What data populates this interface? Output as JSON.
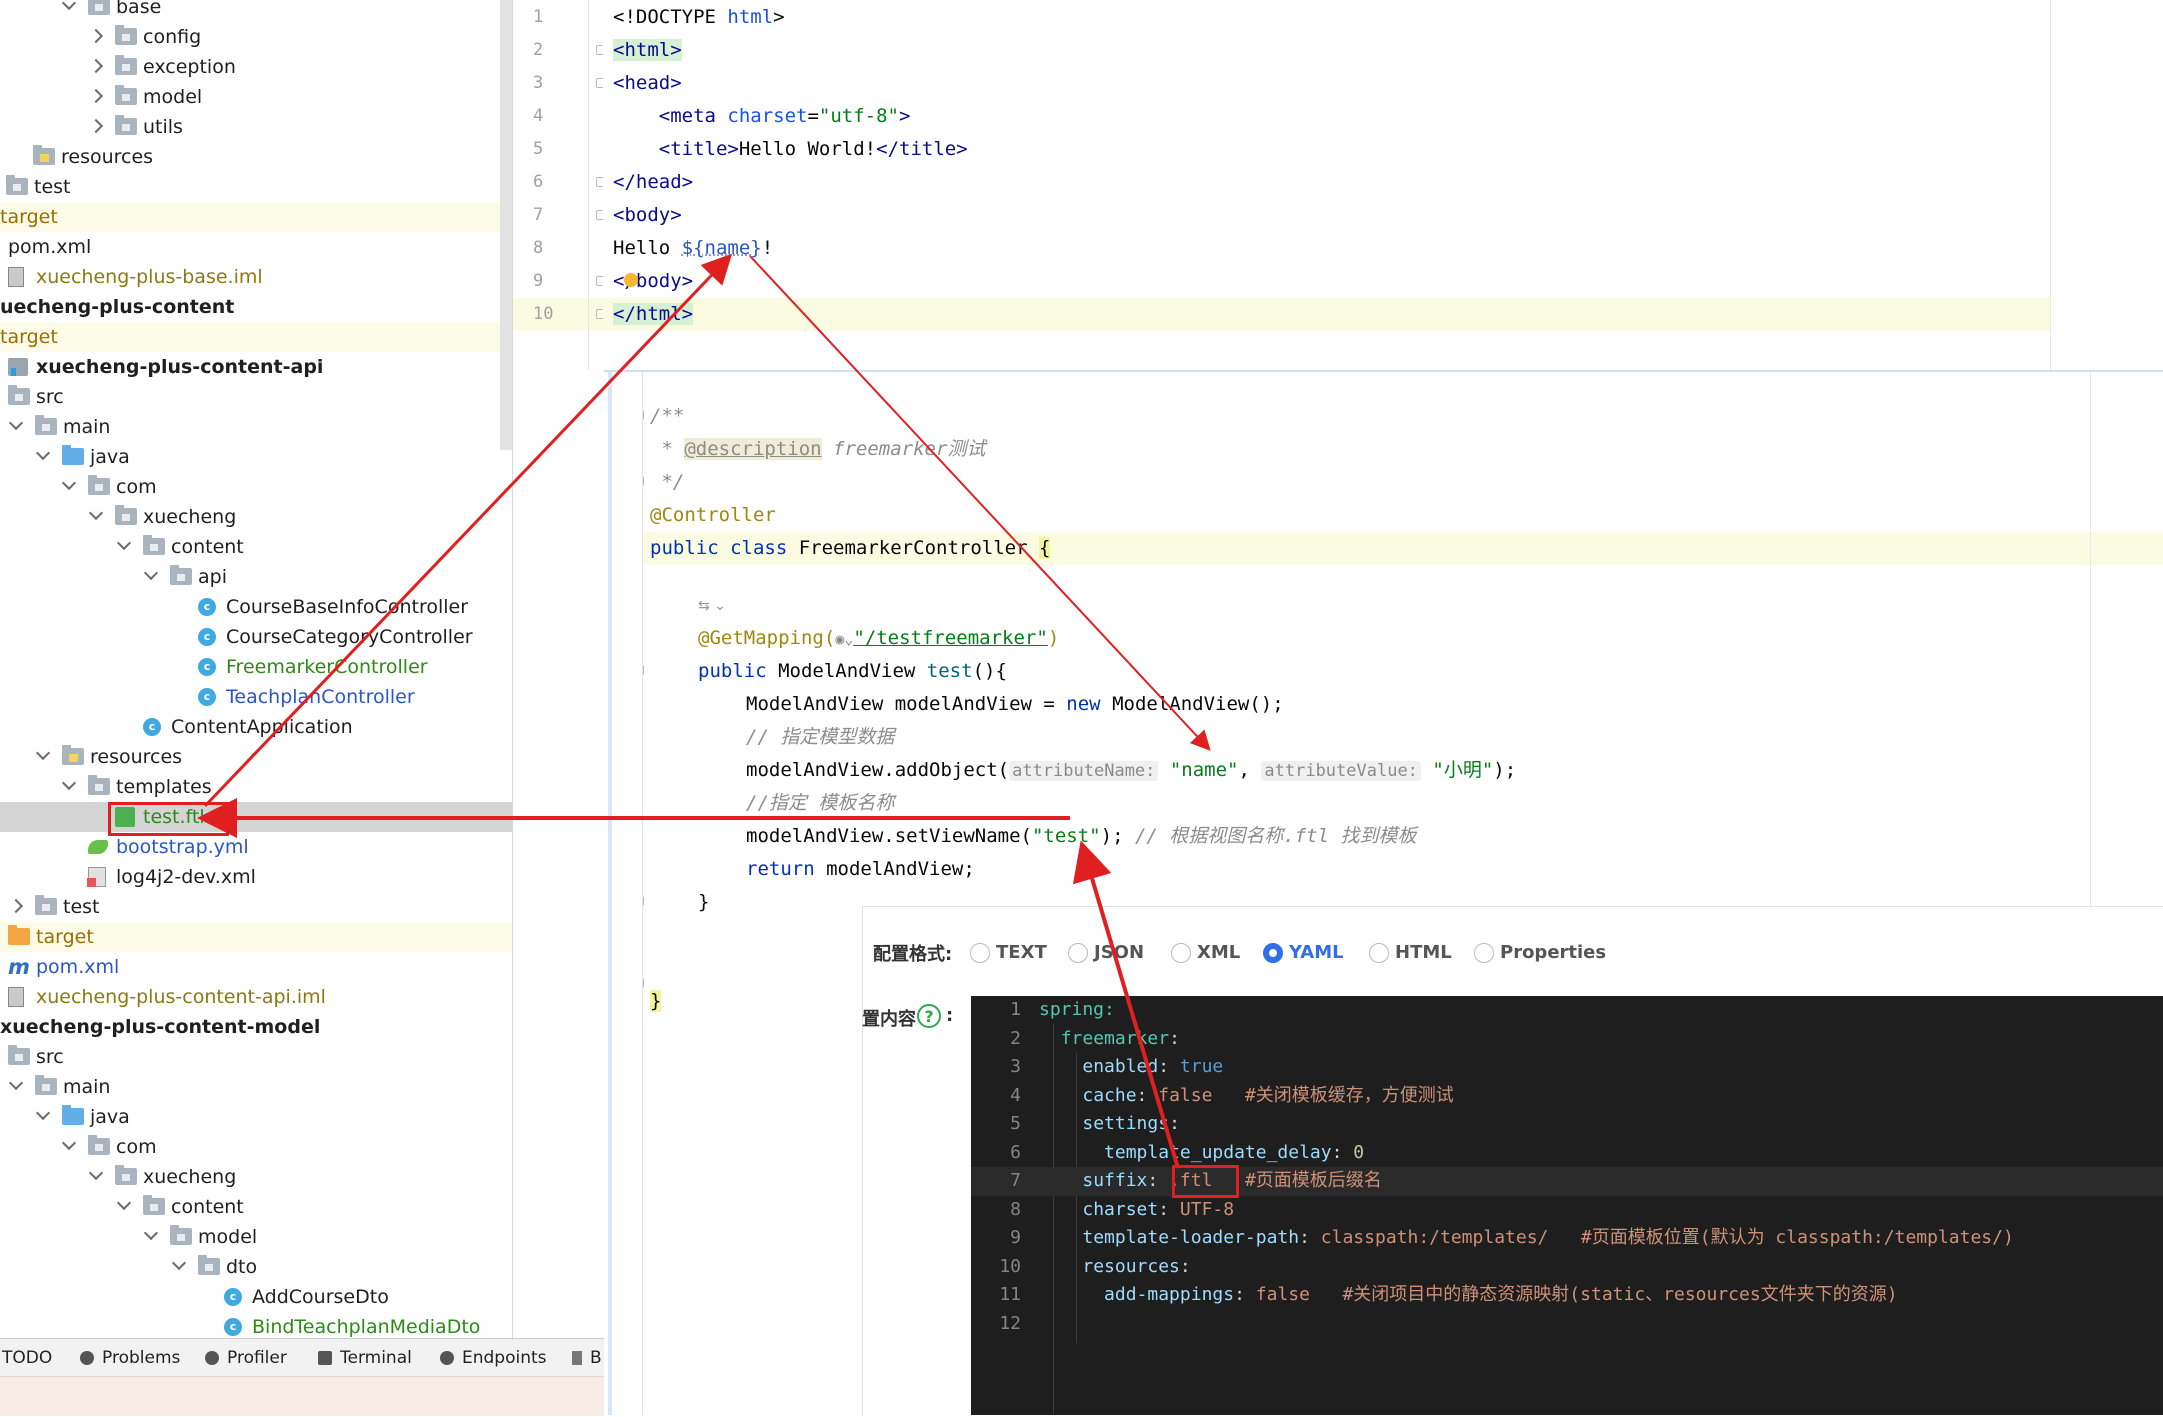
{
  "project_tree": {
    "items": [
      {
        "label": "base",
        "icon": "folder-icon",
        "style": "normal"
      },
      {
        "label": "config",
        "icon": "folder-icon",
        "style": "normal"
      },
      {
        "label": "exception",
        "icon": "folder-icon",
        "style": "normal"
      },
      {
        "label": "model",
        "icon": "folder-icon",
        "style": "normal"
      },
      {
        "label": "utils",
        "icon": "folder-icon",
        "style": "normal"
      },
      {
        "label": "resources",
        "icon": "resources-folder-icon",
        "style": "normal"
      },
      {
        "label": "test",
        "icon": "folder-icon",
        "style": "normal"
      },
      {
        "label": "target",
        "icon": "none",
        "style": "excluded"
      },
      {
        "label": "pom.xml",
        "icon": "none",
        "style": "normal"
      },
      {
        "label": "xuecheng-plus-base.iml",
        "icon": "iml-icon",
        "style": "olive"
      },
      {
        "label": "uecheng-plus-content",
        "icon": "none",
        "style": "module"
      },
      {
        "label": "target",
        "icon": "none",
        "style": "excluded"
      },
      {
        "label": "xuecheng-plus-content-api",
        "icon": "module-icon",
        "style": "module"
      },
      {
        "label": "src",
        "icon": "folder-icon",
        "style": "normal"
      },
      {
        "label": "main",
        "icon": "folder-icon",
        "style": "normal"
      },
      {
        "label": "java",
        "icon": "source-folder-icon",
        "style": "normal"
      },
      {
        "label": "com",
        "icon": "package-icon",
        "style": "normal"
      },
      {
        "label": "xuecheng",
        "icon": "package-icon",
        "style": "normal"
      },
      {
        "label": "content",
        "icon": "package-icon",
        "style": "normal"
      },
      {
        "label": "api",
        "icon": "package-icon",
        "style": "normal"
      },
      {
        "label": "CourseBaseInfoController",
        "icon": "java-class-icon",
        "style": "normal"
      },
      {
        "label": "CourseCategoryController",
        "icon": "java-class-icon",
        "style": "normal"
      },
      {
        "label": "FreemarkerController",
        "icon": "java-class-icon",
        "style": "added"
      },
      {
        "label": "TeachplanController",
        "icon": "java-class-icon",
        "style": "modified"
      },
      {
        "label": "ContentApplication",
        "icon": "spring-boot-class-icon",
        "style": "normal"
      },
      {
        "label": "resources",
        "icon": "resources-folder-icon",
        "style": "normal"
      },
      {
        "label": "templates",
        "icon": "folder-icon",
        "style": "normal"
      },
      {
        "label": "test.ftl",
        "icon": "ftl-file-icon",
        "style": "added"
      },
      {
        "label": "bootstrap.yml",
        "icon": "yaml-file-icon",
        "style": "modified"
      },
      {
        "label": "log4j2-dev.xml",
        "icon": "xml-file-icon",
        "style": "normal"
      },
      {
        "label": "test",
        "icon": "folder-icon",
        "style": "normal"
      },
      {
        "label": "target",
        "icon": "excluded-folder-icon",
        "style": "excluded"
      },
      {
        "label": "pom.xml",
        "icon": "maven-icon",
        "style": "modified"
      },
      {
        "label": "xuecheng-plus-content-api.iml",
        "icon": "iml-icon",
        "style": "olive"
      },
      {
        "label": "xuecheng-plus-content-model",
        "icon": "none",
        "style": "module"
      },
      {
        "label": "src",
        "icon": "folder-icon",
        "style": "normal"
      },
      {
        "label": "main",
        "icon": "folder-icon",
        "style": "normal"
      },
      {
        "label": "java",
        "icon": "source-folder-icon",
        "style": "normal"
      },
      {
        "label": "com",
        "icon": "package-icon",
        "style": "normal"
      },
      {
        "label": "xuecheng",
        "icon": "package-icon",
        "style": "normal"
      },
      {
        "label": "content",
        "icon": "package-icon",
        "style": "normal"
      },
      {
        "label": "model",
        "icon": "package-icon",
        "style": "normal"
      },
      {
        "label": "dto",
        "icon": "package-icon",
        "style": "normal"
      },
      {
        "label": "AddCourseDto",
        "icon": "java-class-icon",
        "style": "normal"
      },
      {
        "label": "BindTeachplanMediaDto",
        "icon": "java-class-icon",
        "style": "added"
      }
    ]
  },
  "bottom_tabs": [
    "TODO",
    "Problems",
    "Profiler",
    "Terminal",
    "Endpoints",
    "B"
  ],
  "html_editor": {
    "line_numbers": [
      "1",
      "2",
      "3",
      "4",
      "5",
      "6",
      "7",
      "8",
      "9",
      "10"
    ],
    "lines": {
      "l1_a": "<!DOCTYPE ",
      "l1_b": "html",
      "l1_c": ">",
      "l2": "<html>",
      "l3": "<head>",
      "l4_a": "    <meta ",
      "l4_b": "charset",
      "l4_c": "=",
      "l4_d": "\"utf-8\"",
      "l4_e": ">",
      "l5_a": "    <title>",
      "l5_b": "Hello World!",
      "l5_c": "</title>",
      "l6": "</head>",
      "l7": "<body>",
      "l8_a": "Hello ",
      "l8_b": "${name}",
      "l8_c": "!",
      "l9": "</body>",
      "l10": "</html>"
    }
  },
  "java_editor": {
    "doc_open": "/**",
    "doc_star": " * ",
    "doc_tag": "@description",
    "doc_text": " freemarker测试",
    "doc_close": " */",
    "controller_annotation": "@Controller",
    "class_kw1": "public",
    "class_kw2": "class",
    "class_name": " FreemarkerController ",
    "brace_open": "{",
    "getmapping": "@GetMapping(",
    "getmapping_path": "\"/testfreemarker\"",
    "getmapping_close": ")",
    "method_kw": "public",
    "method_type": " ModelAndView ",
    "method_name": "test",
    "method_tail": "(){",
    "line_new_a": "ModelAndView modelAndView = ",
    "line_new_kw": "new",
    "line_new_b": " ModelAndView();",
    "comment_model": "// 指定模型数据",
    "addobj_a": "modelAndView.addObject(",
    "hint_attr_name": "attributeName:",
    "addobj_name": "\"name\"",
    "addobj_comma": ", ",
    "hint_attr_value": "attributeValue:",
    "addobj_value": "\"小明\"",
    "addobj_close": ");",
    "comment_template": "//指定 模板名称",
    "setview_a": "modelAndView.setViewName(",
    "setview_str": "\"test\"",
    "setview_close": ");",
    "setview_comment": "// 根据视图名称.ftl 找到模板",
    "return_kw": "return",
    "return_rest": " modelAndView;",
    "method_close": "}",
    "class_close": "}"
  },
  "config_panel": {
    "format_label": "配置格式:",
    "formats": [
      {
        "label": "TEXT",
        "selected": false
      },
      {
        "label": "JSON",
        "selected": false
      },
      {
        "label": "XML",
        "selected": false
      },
      {
        "label": "YAML",
        "selected": true
      },
      {
        "label": "HTML",
        "selected": false
      },
      {
        "label": "Properties",
        "selected": false
      }
    ],
    "content_label": "置内容",
    "content_colon": ":",
    "help_glyph": "?",
    "yaml_line_numbers": [
      "1",
      "2",
      "3",
      "4",
      "5",
      "6",
      "7",
      "8",
      "9",
      "10",
      "11",
      "12"
    ],
    "yaml": {
      "l1": "spring:",
      "l2_k": "freemarker",
      "l2_c": ":",
      "l3_k": "enabled",
      "l3_v": "true",
      "l4_k": "cache",
      "l4_v": "false",
      "l4_cm": "#关闭模板缓存，方便测试",
      "l5_k": "settings",
      "l5_c": ":",
      "l6_k": "template_update_delay",
      "l6_v": "0",
      "l7_k": "suffix",
      "l7_v": ".ftl",
      "l7_cm": "#页面模板后缀名",
      "l8_k": "charset",
      "l8_v": "UTF-8",
      "l9_k": "template-loader-path",
      "l9_v": "classpath:/templates/",
      "l9_cm": "#页面模板位置(默认为 classpath:/templates/)",
      "l10_k": "resources",
      "l10_c": ":",
      "l11_k": "add-mappings",
      "l11_v": "false",
      "l11_cm": "#关闭项目中的静态资源映射(static、resources文件夹下的资源)"
    }
  },
  "colors": {
    "annotation_red": "#e02020",
    "selected_radio": "#2f6fe8",
    "yaml_background": "#1e1e1e"
  }
}
